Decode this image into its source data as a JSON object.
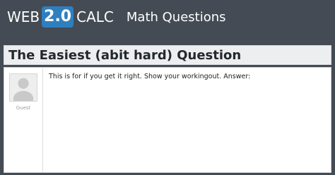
{
  "header": {
    "logo_prefix": "WEB",
    "logo_badge": "2.0",
    "logo_suffix": "CALC",
    "section": "Math Questions"
  },
  "question": {
    "title": "The Easiest (abit hard) Question",
    "author": "Guest",
    "body": "This is for if you get it right. Show your workingout. Answer:"
  },
  "colors": {
    "background": "#444b54",
    "logo_badge": "#2f7fbf",
    "title_bar": "#eceeef",
    "post_background": "#ffffff"
  },
  "icons": {
    "avatar": "default-user-avatar-icon"
  }
}
